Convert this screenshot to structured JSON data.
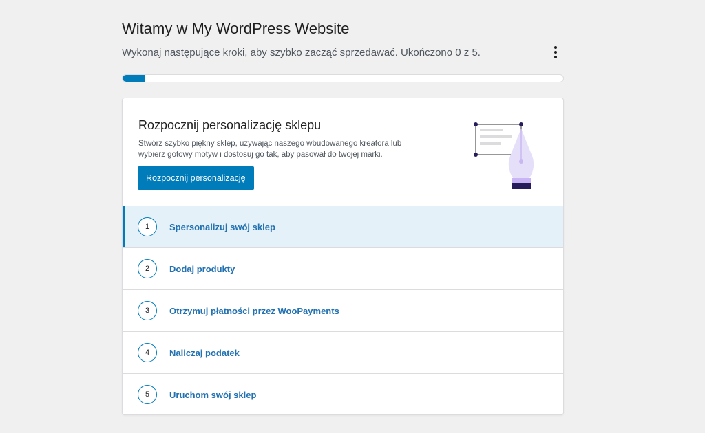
{
  "header": {
    "title": "Witamy w My WordPress Website",
    "subtitle": "Wykonaj następujące kroki, aby szybko zacząć sprzedawać. Ukończono 0 z 5.",
    "progress_fraction": 0.05
  },
  "hero": {
    "title": "Rozpocznij personalizację sklepu",
    "description": "Stwórz szybko piękny sklep, używając naszego wbudowanego kreatora lub wybierz gotowy motyw i dostosuj go tak, aby pasował do twojej marki.",
    "button_label": "Rozpocznij personalizację",
    "illustration_icon": "pen-design-icon"
  },
  "steps": [
    {
      "number": "1",
      "label": "Spersonalizuj swój sklep",
      "active": true
    },
    {
      "number": "2",
      "label": "Dodaj produkty",
      "active": false
    },
    {
      "number": "3",
      "label": "Otrzymuj płatności przez WooPayments",
      "active": false
    },
    {
      "number": "4",
      "label": "Naliczaj podatek",
      "active": false
    },
    {
      "number": "5",
      "label": "Uruchom swój sklep",
      "active": false
    }
  ],
  "colors": {
    "accent": "#007cba",
    "link": "#2271b1",
    "active_row": "#e5f1f8",
    "background": "#f0f0f1"
  }
}
